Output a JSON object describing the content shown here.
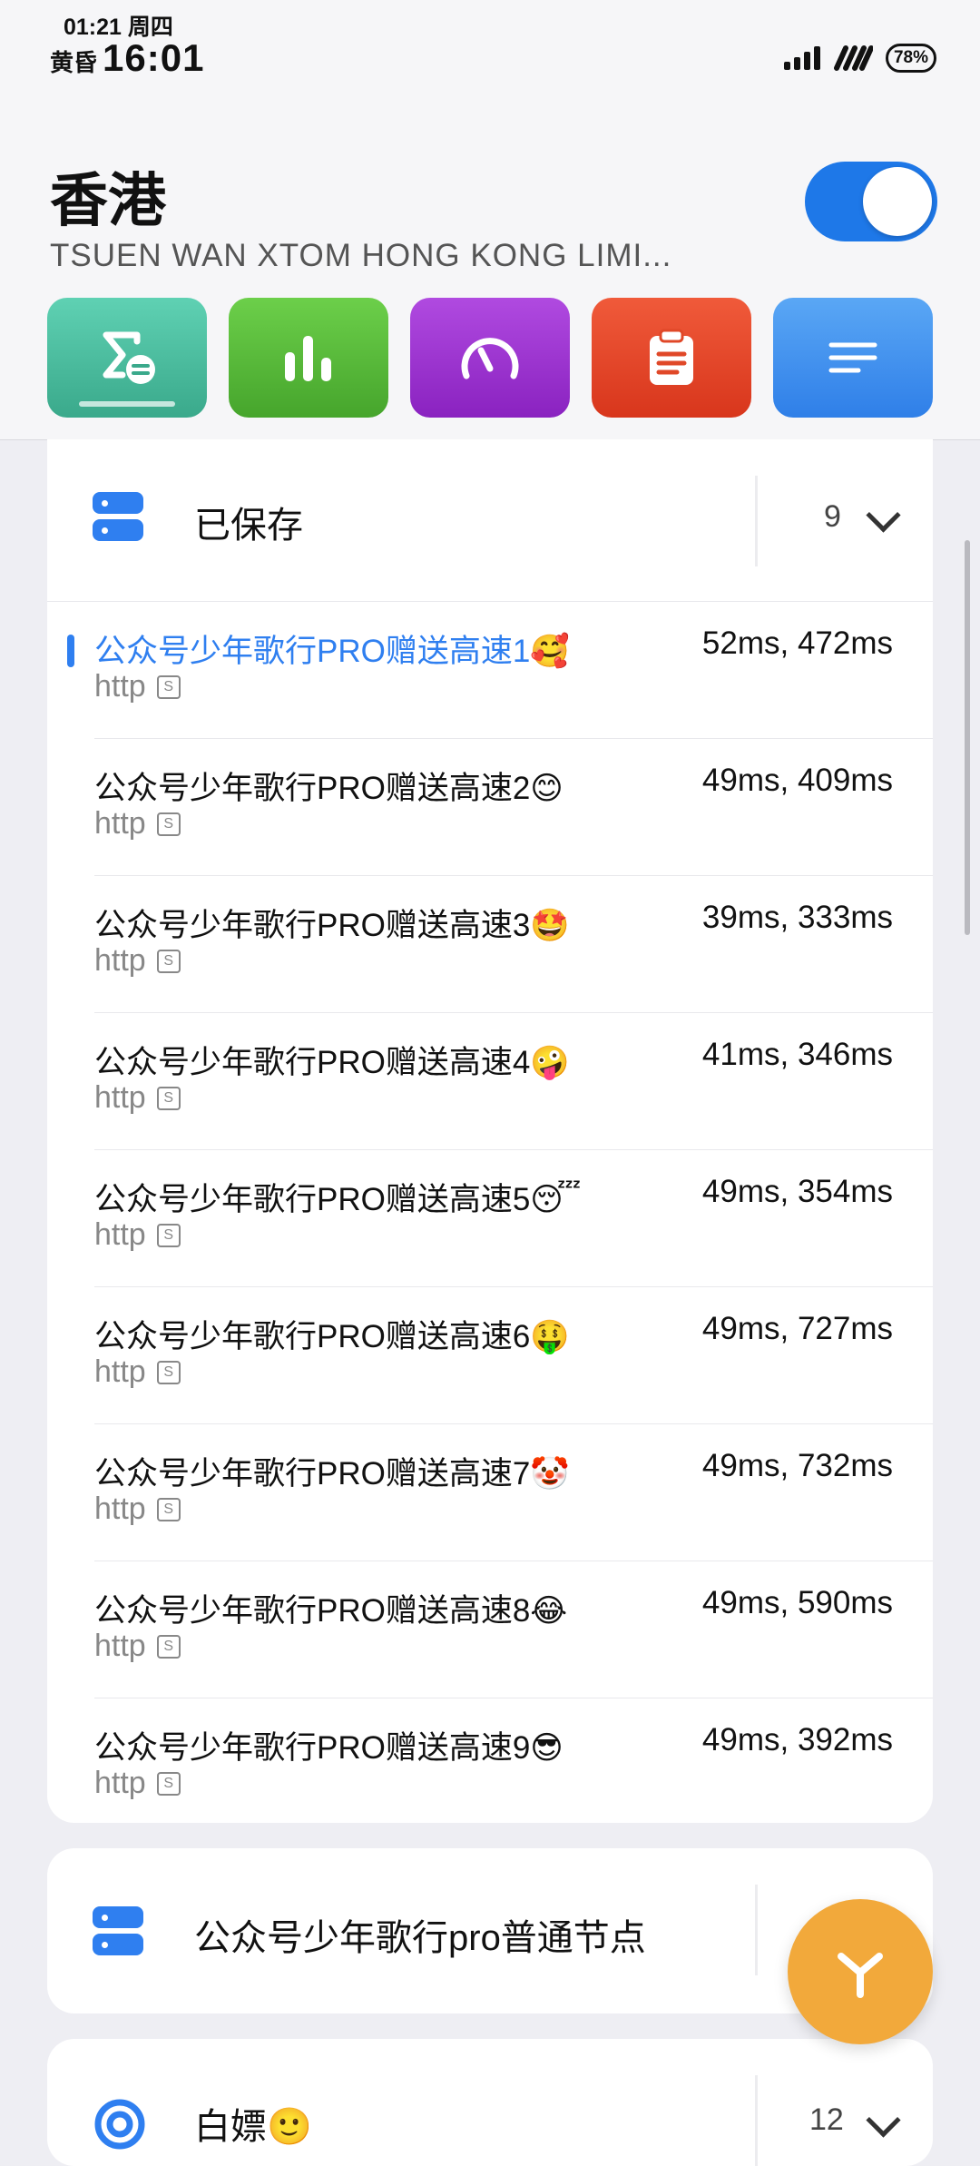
{
  "status": {
    "small_time": "01:21 周四",
    "prefix": "黄昏",
    "clock": "16:01",
    "battery": "78%"
  },
  "header": {
    "title": "香港",
    "subtitle": "TSUEN WAN XTOM HONG KONG LIMI..."
  },
  "toolbar": {
    "icons": [
      "sigma-list-icon",
      "bar-chart-icon",
      "speedometer-icon",
      "clipboard-icon",
      "menu-lines-icon"
    ]
  },
  "group_saved": {
    "title": "已保存",
    "count": "9",
    "nodes": [
      {
        "name": "公众号少年歌行PRO赠送高速1🥰",
        "proto": "http",
        "latency": "52ms, 472ms",
        "selected": true
      },
      {
        "name": "公众号少年歌行PRO赠送高速2😊",
        "proto": "http",
        "latency": "49ms, 409ms"
      },
      {
        "name": "公众号少年歌行PRO赠送高速3🤩",
        "proto": "http",
        "latency": "39ms, 333ms"
      },
      {
        "name": "公众号少年歌行PRO赠送高速4🤪",
        "proto": "http",
        "latency": "41ms, 346ms"
      },
      {
        "name": "公众号少年歌行PRO赠送高速5😴",
        "proto": "http",
        "latency": "49ms, 354ms"
      },
      {
        "name": "公众号少年歌行PRO赠送高速6🤑",
        "proto": "http",
        "latency": "49ms, 727ms"
      },
      {
        "name": "公众号少年歌行PRO赠送高速7🤡",
        "proto": "http",
        "latency": "49ms, 732ms"
      },
      {
        "name": "公众号少年歌行PRO赠送高速8😂",
        "proto": "http",
        "latency": "49ms, 590ms"
      },
      {
        "name": "公众号少年歌行PRO赠送高速9😎",
        "proto": "http",
        "latency": "49ms, 392ms"
      }
    ]
  },
  "group_normal": {
    "title": "公众号少年歌行pro普通节点"
  },
  "group_free": {
    "title": "白嫖🙂",
    "count": "12"
  }
}
